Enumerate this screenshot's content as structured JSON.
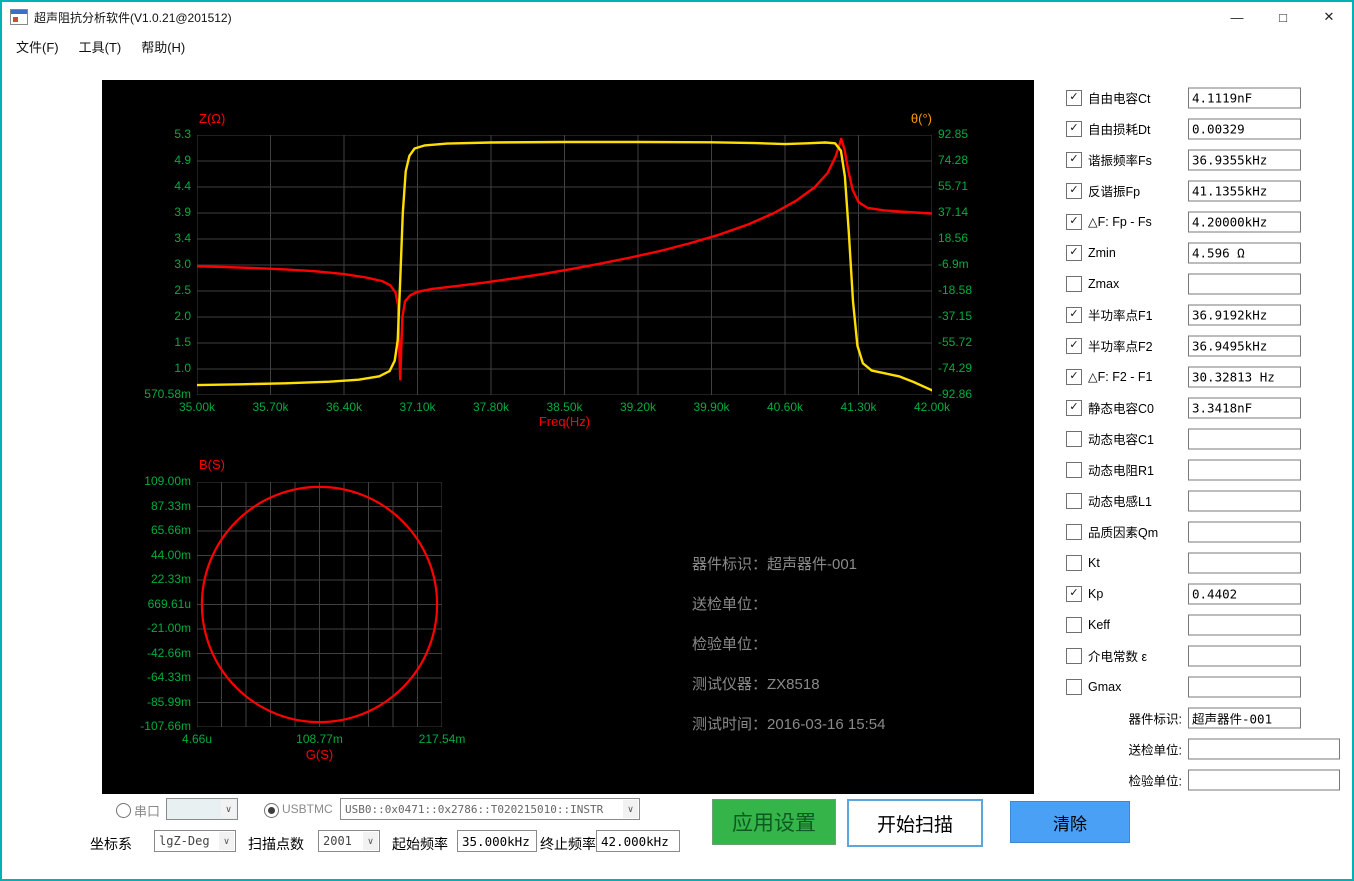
{
  "window": {
    "title": "超声阻抗分析软件(V1.0.21@201512)",
    "controls": {
      "minimize": "—",
      "maximize": "□",
      "close": "✕"
    }
  },
  "menu": {
    "file": "文件(F)",
    "tools": "工具(T)",
    "help": "帮助(H)"
  },
  "icons": {
    "chevron_down": "∨",
    "check": "✓"
  },
  "colors": {
    "window_border": "#00b2b8",
    "curve_impedance": "#ff0000",
    "curve_phase": "#ffdf00",
    "theta_label": "#ff9900",
    "tick_text": "#00ad3f",
    "grid_line": "#404040",
    "info_text": "#8a8a8a",
    "apply_bg": "#35b44a",
    "apply_text": "#0d5a20",
    "scan_border": "#5aa7dd",
    "clear_bg": "#4aa0f5"
  },
  "chart_data": [
    {
      "type": "line",
      "coords": "points are normalized [x, y-from-top] 0-1 within plot area",
      "xlabel": "Freq(Hz)",
      "y_left_label": "Z(Ω)",
      "y_right_label": "θ(°)",
      "x_range_hz": [
        35000,
        42000
      ],
      "grid": true,
      "x_ticks": [
        "35.00k",
        "35.70k",
        "36.40k",
        "37.10k",
        "37.80k",
        "38.50k",
        "39.20k",
        "39.90k",
        "40.60k",
        "41.30k",
        "42.00k"
      ],
      "y_left_ticks": [
        "5.3",
        "4.9",
        "4.4",
        "3.9",
        "3.4",
        "3.0",
        "2.5",
        "2.0",
        "1.5",
        "1.0",
        "570.58m"
      ],
      "y_right_ticks": [
        "92.85",
        "74.28",
        "55.71",
        "37.14",
        "18.56",
        "-6.9m",
        "-18.58",
        "-37.15",
        "-55.72",
        "-74.29",
        "-92.86"
      ],
      "series": [
        {
          "name": "impedance-Z",
          "color": "#ff0000",
          "axis": "left",
          "points": [
            [
              0.0,
              0.505
            ],
            [
              0.04,
              0.508
            ],
            [
              0.08,
              0.512
            ],
            [
              0.12,
              0.517
            ],
            [
              0.16,
              0.524
            ],
            [
              0.2,
              0.535
            ],
            [
              0.23,
              0.548
            ],
            [
              0.252,
              0.562
            ],
            [
              0.263,
              0.578
            ],
            [
              0.27,
              0.605
            ],
            [
              0.2735,
              0.655
            ],
            [
              0.2765,
              0.94
            ],
            [
              0.2795,
              0.7
            ],
            [
              0.283,
              0.64
            ],
            [
              0.29,
              0.617
            ],
            [
              0.3,
              0.603
            ],
            [
              0.32,
              0.592
            ],
            [
              0.35,
              0.582
            ],
            [
              0.39,
              0.568
            ],
            [
              0.43,
              0.552
            ],
            [
              0.47,
              0.535
            ],
            [
              0.51,
              0.515
            ],
            [
              0.55,
              0.494
            ],
            [
              0.59,
              0.471
            ],
            [
              0.63,
              0.446
            ],
            [
              0.67,
              0.417
            ],
            [
              0.71,
              0.384
            ],
            [
              0.75,
              0.344
            ],
            [
              0.785,
              0.3
            ],
            [
              0.815,
              0.253
            ],
            [
              0.84,
              0.202
            ],
            [
              0.858,
              0.146
            ],
            [
              0.869,
              0.082
            ],
            [
              0.8765,
              0.015
            ],
            [
              0.881,
              0.055
            ],
            [
              0.886,
              0.135
            ],
            [
              0.892,
              0.21
            ],
            [
              0.9,
              0.258
            ],
            [
              0.912,
              0.28
            ],
            [
              0.935,
              0.29
            ],
            [
              0.965,
              0.296
            ],
            [
              1.0,
              0.302
            ]
          ]
        },
        {
          "name": "phase-theta",
          "color": "#ffdf00",
          "axis": "right",
          "points": [
            [
              0.0,
              0.962
            ],
            [
              0.06,
              0.959
            ],
            [
              0.12,
              0.955
            ],
            [
              0.18,
              0.949
            ],
            [
              0.22,
              0.941
            ],
            [
              0.248,
              0.928
            ],
            [
              0.262,
              0.908
            ],
            [
              0.269,
              0.868
            ],
            [
              0.273,
              0.79
            ],
            [
              0.2765,
              0.56
            ],
            [
              0.28,
              0.3
            ],
            [
              0.284,
              0.14
            ],
            [
              0.289,
              0.08
            ],
            [
              0.296,
              0.052
            ],
            [
              0.31,
              0.04
            ],
            [
              0.34,
              0.033
            ],
            [
              0.4,
              0.029
            ],
            [
              0.5,
              0.027
            ],
            [
              0.6,
              0.027
            ],
            [
              0.7,
              0.028
            ],
            [
              0.76,
              0.031
            ],
            [
              0.8,
              0.035
            ],
            [
              0.83,
              0.032
            ],
            [
              0.855,
              0.029
            ],
            [
              0.868,
              0.032
            ],
            [
              0.876,
              0.06
            ],
            [
              0.8815,
              0.16
            ],
            [
              0.887,
              0.38
            ],
            [
              0.8925,
              0.64
            ],
            [
              0.8985,
              0.81
            ],
            [
              0.906,
              0.878
            ],
            [
              0.918,
              0.906
            ],
            [
              0.935,
              0.916
            ],
            [
              0.955,
              0.928
            ],
            [
              0.975,
              0.95
            ],
            [
              1.0,
              0.982
            ]
          ]
        }
      ]
    },
    {
      "type": "line",
      "coords": "circle in normalized 0-1 plot coordinates",
      "ylabel": "B(S)",
      "xlabel": "G(S)",
      "grid": true,
      "x_ticks": [
        "4.66u",
        "108.77m",
        "217.54m"
      ],
      "y_ticks": [
        "109.00m",
        "87.33m",
        "65.66m",
        "44.00m",
        "22.33m",
        "669.61u",
        "-21.00m",
        "-42.66m",
        "-64.33m",
        "-85.99m",
        "-107.66m"
      ],
      "series": [
        {
          "name": "admittance-circle",
          "color": "#ff0000",
          "circle": {
            "cx": 0.5,
            "cy": 0.5,
            "r": 0.48
          }
        }
      ]
    }
  ],
  "info": {
    "device": "器件标识：超声器件-001",
    "sender": "送检单位：",
    "inspector": "检验单位：",
    "instrument": "测试仪器：ZX8518",
    "time": "测试时间：2016-03-16 15:54"
  },
  "results": {
    "rows": [
      {
        "label": "自由电容Ct",
        "checked": true,
        "value": "4.1119nF"
      },
      {
        "label": "自由损耗Dt",
        "checked": true,
        "value": "0.00329"
      },
      {
        "label": "谐振频率Fs",
        "checked": true,
        "value": "36.9355kHz"
      },
      {
        "label": "反谐振Fp",
        "checked": true,
        "value": "41.1355kHz"
      },
      {
        "label": "△F: Fp - Fs",
        "checked": true,
        "value": "4.20000kHz"
      },
      {
        "label": "Zmin",
        "checked": true,
        "value": "4.596 Ω"
      },
      {
        "label": "Zmax",
        "checked": false,
        "value": ""
      },
      {
        "label": "半功率点F1",
        "checked": true,
        "value": "36.9192kHz"
      },
      {
        "label": "半功率点F2",
        "checked": true,
        "value": "36.9495kHz"
      },
      {
        "label": "△F: F2 - F1",
        "checked": true,
        "value": "30.32813 Hz"
      },
      {
        "label": "静态电容C0",
        "checked": true,
        "value": "3.3418nF"
      },
      {
        "label": "动态电容C1",
        "checked": false,
        "value": ""
      },
      {
        "label": "动态电阻R1",
        "checked": false,
        "value": ""
      },
      {
        "label": "动态电感L1",
        "checked": false,
        "value": ""
      },
      {
        "label": "品质因素Qm",
        "checked": false,
        "value": ""
      },
      {
        "label": "Kt",
        "checked": false,
        "value": ""
      },
      {
        "label": "Kp",
        "checked": true,
        "value": "0.4402"
      },
      {
        "label": "Keff",
        "checked": false,
        "value": ""
      },
      {
        "label": "介电常数 ε",
        "checked": false,
        "value": ""
      },
      {
        "label": "Gmax",
        "checked": false,
        "value": ""
      }
    ],
    "fields": [
      {
        "label": "器件标识:",
        "value": "超声器件-001"
      },
      {
        "label": "送检单位:",
        "value": ""
      },
      {
        "label": "检验单位:",
        "value": ""
      }
    ]
  },
  "connection": {
    "serial_label": "串口",
    "serial_selected": false,
    "usbtmc_label": "USBTMC",
    "usbtmc_selected": true,
    "usbtmc_value": "USB0::0x0471::0x2786::T020215010::INSTR"
  },
  "sweep": {
    "coord_label": "坐标系",
    "coord_value": "lgZ-Deg",
    "points_label": "扫描点数",
    "points_value": "2001",
    "start_label": "起始频率",
    "start_value": "35.000kHz",
    "stop_label": "终止频率",
    "stop_value": "42.000kHz"
  },
  "buttons": {
    "apply": "应用设置",
    "scan": "开始扫描",
    "clear": "清除"
  }
}
